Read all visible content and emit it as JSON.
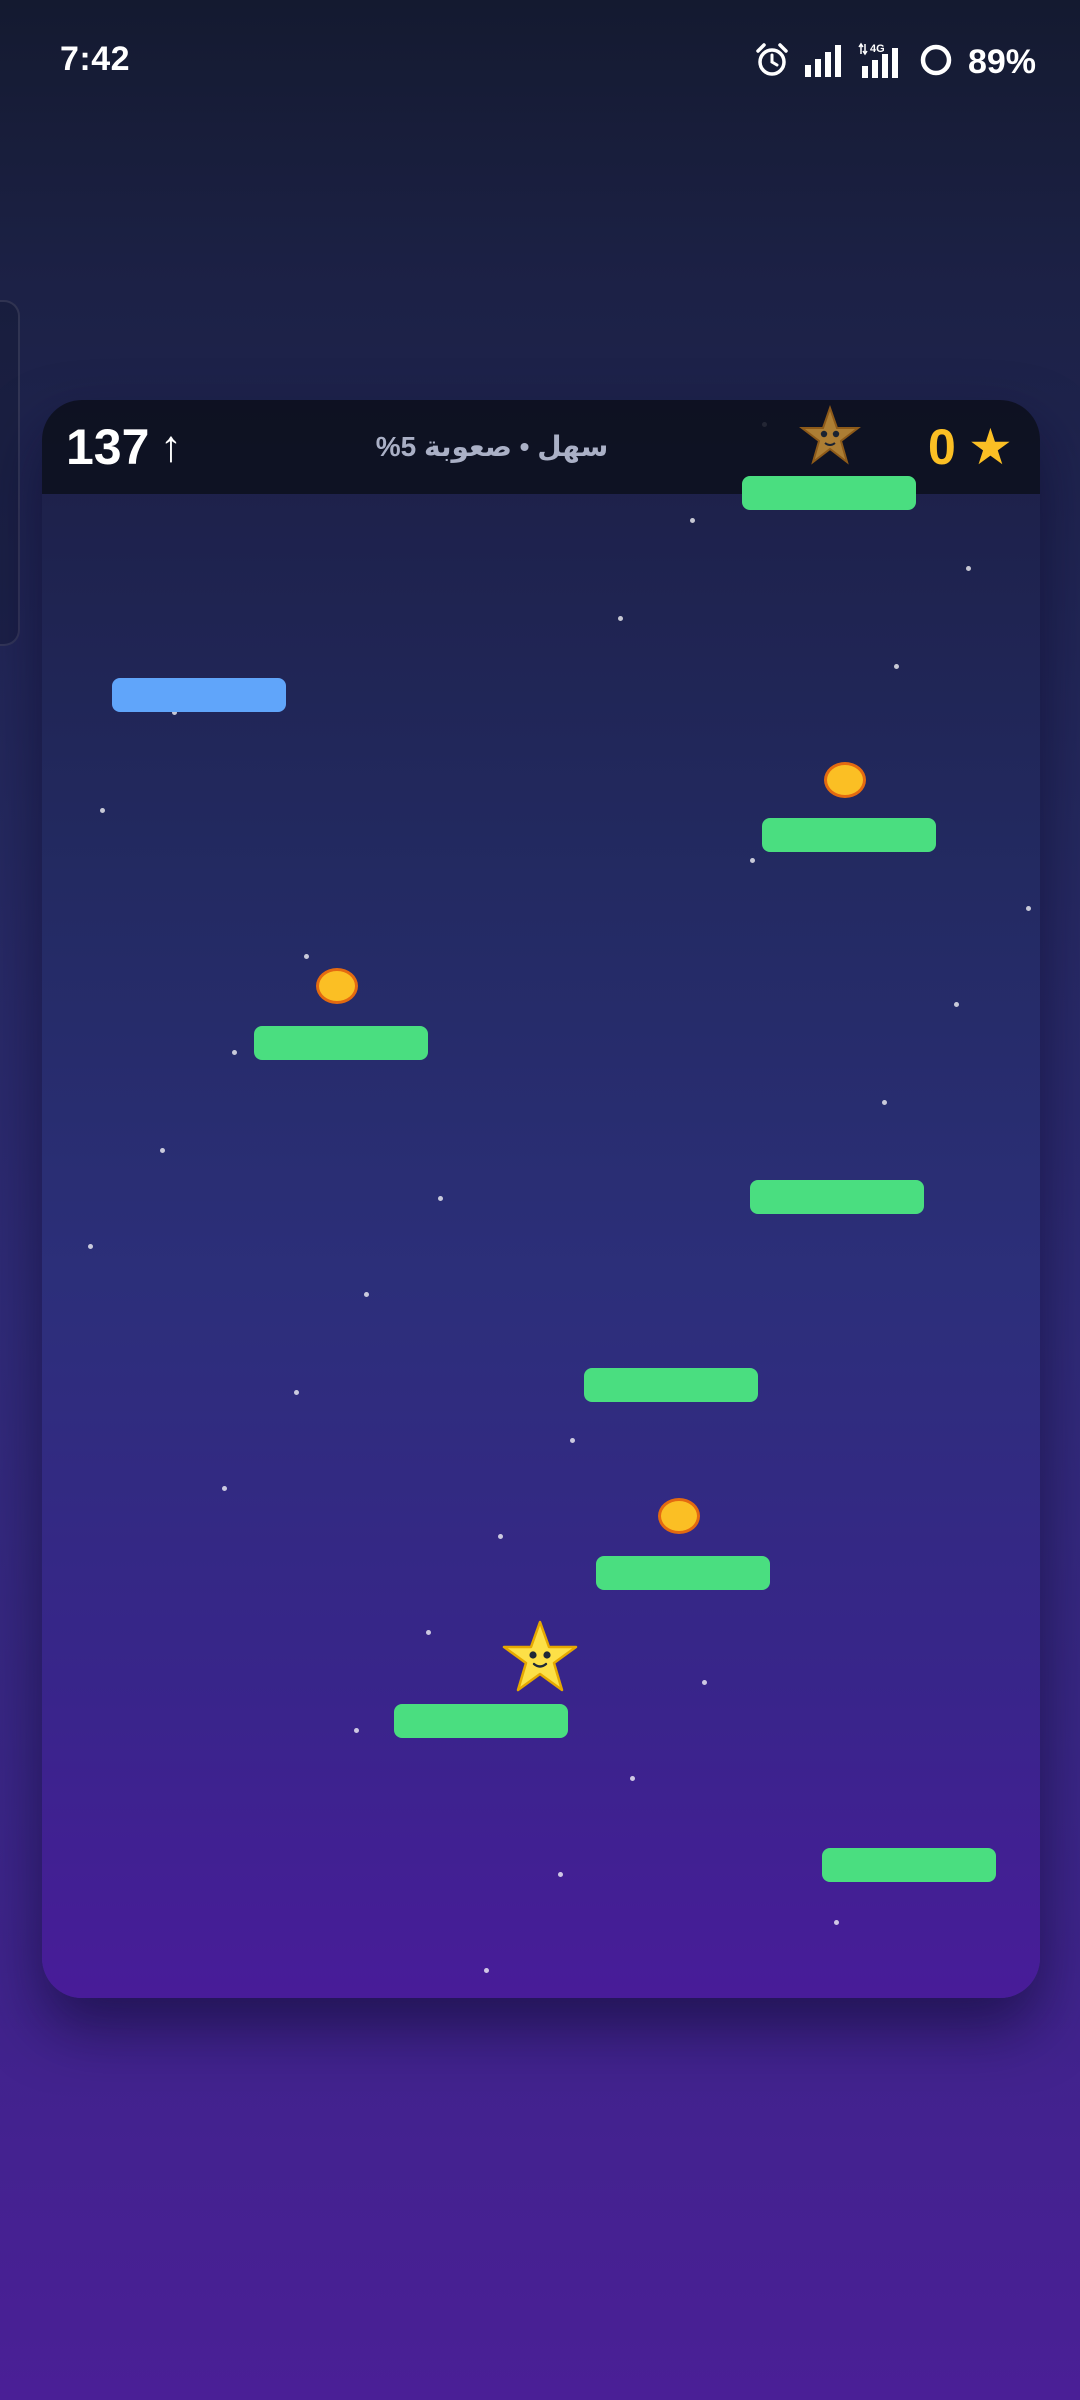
{
  "status_bar": {
    "time": "7:42",
    "battery": "89%",
    "network": "4G",
    "icons": [
      "alarm-icon",
      "signal-icon",
      "signal-4g-icon",
      "battery-ring-icon"
    ]
  },
  "hud": {
    "height": "137",
    "height_arrow": "↑",
    "difficulty": "سهل • صعوبة 5%",
    "score": "0",
    "score_icon": "★"
  },
  "game": {
    "platforms": [
      {
        "kind": "green"
      },
      {
        "kind": "blue"
      },
      {
        "kind": "green"
      },
      {
        "kind": "green"
      },
      {
        "kind": "green"
      },
      {
        "kind": "green"
      },
      {
        "kind": "green"
      },
      {
        "kind": "green"
      },
      {
        "kind": "green"
      }
    ],
    "coins": 3,
    "colors": {
      "platform_green": "#4ade80",
      "platform_blue": "#60a5fa",
      "coin": "#fbbf24",
      "coin_border": "#e46a10",
      "star_player": "#fde047",
      "score_accent": "#fbbf24"
    }
  }
}
